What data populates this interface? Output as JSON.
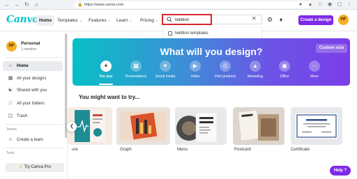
{
  "browser": {
    "url": "https://www.canva.com",
    "back_icon": "arrow-left-icon",
    "forward_icon": "arrow-right-icon",
    "reload_icon": "reload-icon",
    "home_icon": "home-icon"
  },
  "header": {
    "logo": "Canva",
    "home_label": "Home",
    "nav": [
      {
        "label": "Templates"
      },
      {
        "label": "Features"
      },
      {
        "label": "Learn"
      },
      {
        "label": "Pricing"
      }
    ],
    "search": {
      "value": "twitition",
      "placeholder": ""
    },
    "create_label": "Create a design",
    "avatar_initials": "HF",
    "accent": "#7d2ae8",
    "highlight": "#d8232a"
  },
  "suggestion": {
    "label": "twitition templates"
  },
  "sidebar": {
    "avatar_initials": "HF",
    "account_name": "Personal",
    "account_members": "1 member",
    "items": [
      {
        "label": "Home"
      },
      {
        "label": "All your designs"
      },
      {
        "label": "Shared with you"
      },
      {
        "label": "All your folders"
      },
      {
        "label": "Trash"
      }
    ],
    "teams_heading": "Teams",
    "create_team": "Create a team",
    "tools_heading": "Tools",
    "try_pro": "Try Canva Pro"
  },
  "hero": {
    "title": "What will you design?",
    "custom_size": "Custom size",
    "categories": [
      {
        "label": "For you"
      },
      {
        "label": "Presentations"
      },
      {
        "label": "Social media"
      },
      {
        "label": "Video"
      },
      {
        "label": "Print products"
      },
      {
        "label": "Marketing"
      },
      {
        "label": "Office"
      },
      {
        "label": "More"
      }
    ]
  },
  "try_section": {
    "title": "You might want to try...",
    "cards": [
      {
        "label": "ure"
      },
      {
        "label": "Graph"
      },
      {
        "label": "Menu"
      },
      {
        "label": "Postcard"
      },
      {
        "label": "Certificate"
      }
    ]
  },
  "help_label": "Help ?"
}
